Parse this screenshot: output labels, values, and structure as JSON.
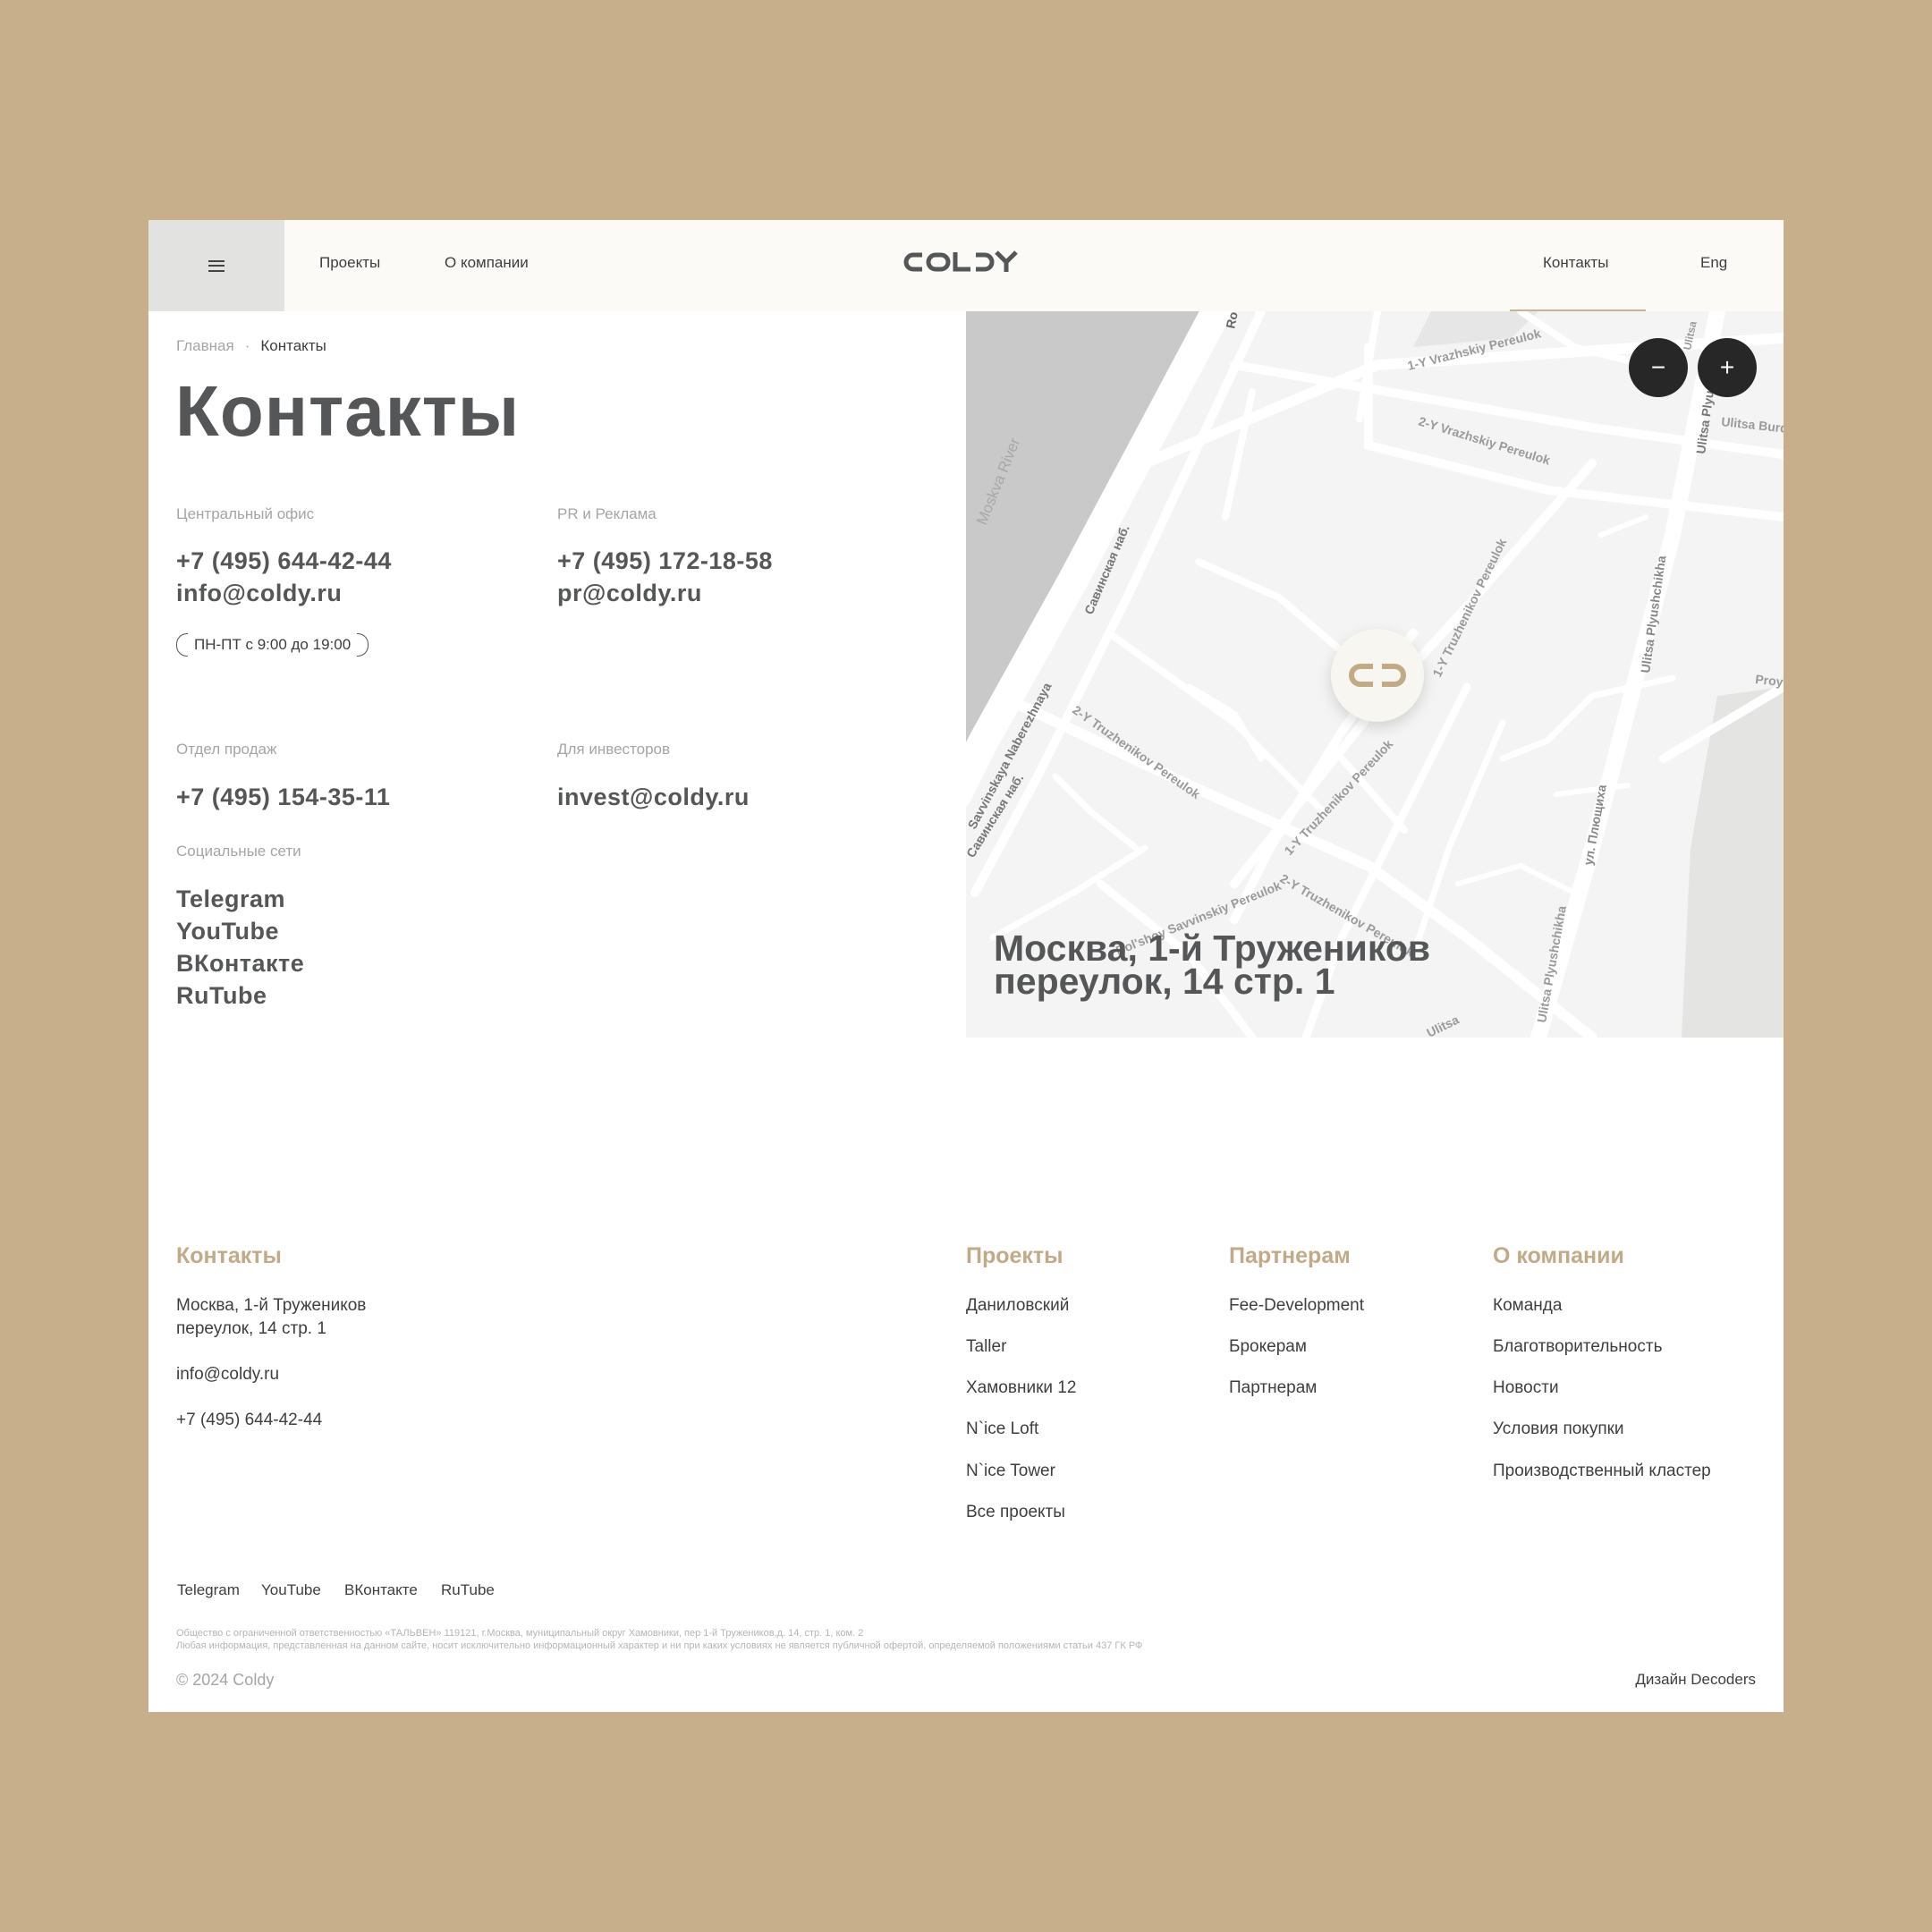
{
  "colors": {
    "background": "#c8af8b",
    "accent": "#c2aa87",
    "text": "#555657",
    "header_bg": "#fbfaf6"
  },
  "header": {
    "menu_icon": "hamburger-icon",
    "nav": {
      "projects": "Проекты",
      "about": "О компании",
      "contacts": "Контакты",
      "lang": "Eng"
    },
    "logo": "COLDY"
  },
  "breadcrumbs": {
    "home": "Главная",
    "current": "Контакты"
  },
  "page_title": "Контакты",
  "contacts": {
    "central": {
      "label": "Центральный офис",
      "phone": "+7 (495) 644-42-44",
      "email": "info@coldy.ru",
      "hours": "ПН-ПТ с 9:00 до 19:00"
    },
    "pr": {
      "label": "PR и Реклама",
      "phone": "+7 (495) 172-18-58",
      "email": "pr@coldy.ru"
    },
    "sales": {
      "label": "Отдел продаж",
      "phone": "+7 (495) 154-35-11"
    },
    "investors": {
      "label": "Для инвесторов",
      "email": "invest@coldy.ru"
    },
    "social": {
      "label": "Социальные сети",
      "items": [
        "Telegram",
        "YouTube",
        "ВКонтакте",
        "RuTube"
      ]
    }
  },
  "map": {
    "zoom_out": "−",
    "zoom_in": "+",
    "address_line1": "Москва, 1-й Тружеников",
    "address_line2": "переулок, 14 стр. 1",
    "labels": {
      "river": "Moskva River",
      "ro": "Ro",
      "vrazh1": "1-Y Vrazhskiy Pereulok",
      "vrazh2": "2-Y Vrazhskiy Pereulok",
      "ulitsa_top": "Ulitsa",
      "plyush_top": "Ulitsa Plyu",
      "burd": "Ulitsa Burd",
      "savv_nab1": "Савинская наб.",
      "truzh1_top": "1-Y Truzhenikov Pereulok",
      "plyush": "Ulitsa Plyushchikha",
      "proy": "Proy",
      "nab_lat": "Savvinskaya Naberezhnaya",
      "savv_nab2": "Савинская наб.",
      "truzh2": "2-Y Truzhenikov Pereulok",
      "truzh1_bottom": "1-Y Truzhenikov Pereulok",
      "plyush_ru": "ул. Плющиха",
      "bsavv": "Bol'shoy Savvinskiy Pereulok",
      "truzh2_bottom": "2-Y Truzhenikov Pereulok",
      "plyush_bottom": "Ulitsa Plyushchikha",
      "ulitsa_bottom": "Ulitsa"
    }
  },
  "footer": {
    "contacts": {
      "title": "Контакты",
      "address_line1": "Москва, 1-й Тружеников",
      "address_line2": "переулок, 14 стр. 1",
      "email": "info@coldy.ru",
      "phone": "+7 (495) 644-42-44"
    },
    "projects": {
      "title": "Проекты",
      "items": [
        "Даниловский",
        "Taller",
        "Хамовники 12",
        "N`ice Loft",
        "N`ice Tower",
        "Все проекты"
      ]
    },
    "partners": {
      "title": "Партнерам",
      "items": [
        "Fee-Development",
        "Брокерам",
        "Партнерам"
      ]
    },
    "about": {
      "title": "О компании",
      "items": [
        "Команда",
        "Благотворительность",
        "Новости",
        "Условия покупки",
        "Производственный кластер"
      ]
    },
    "social": [
      "Telegram",
      "YouTube",
      "ВКонтакте",
      "RuTube"
    ],
    "legal_line1": "Общество с ограниченной ответственностью «ТАЛЬВЕН» 119121, г.Москва, муниципальный округ Хамовники, пер 1-й Тружеников,д. 14, стр. 1, ком. 2",
    "legal_line2": "Любая информация, представленная на данном сайте, носит исключительно информационный характер и ни при каких условиях не является публичной офертой, определяемой положениями статьи 437 ГК РФ",
    "copyright": "© 2024  Coldy",
    "design": "Дизайн Decoders"
  }
}
